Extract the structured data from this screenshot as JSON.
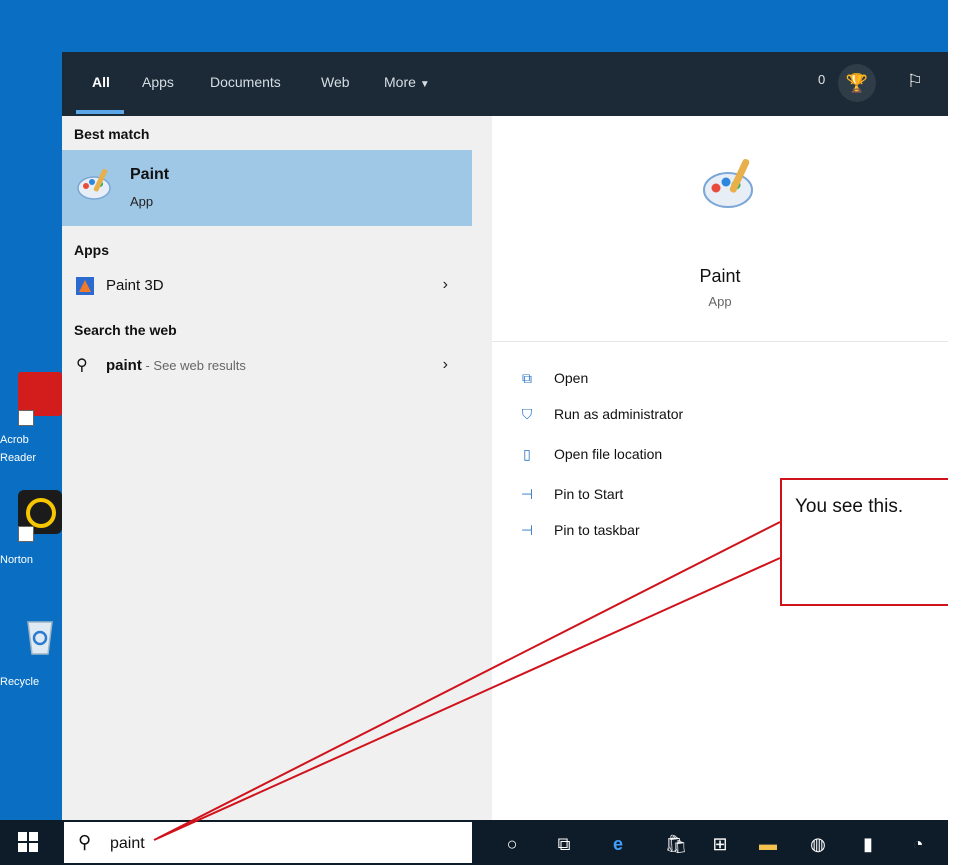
{
  "desktop": {
    "icons": [
      {
        "label_line1": "Acrob",
        "label_line2": "Reader"
      },
      {
        "label_line1": "Norton"
      },
      {
        "label_line1": "Recycle"
      }
    ]
  },
  "search_panel": {
    "tabs": [
      {
        "label": "All"
      },
      {
        "label": "Apps"
      },
      {
        "label": "Documents"
      },
      {
        "label": "Web"
      },
      {
        "label": "More"
      }
    ],
    "points": "0",
    "best_match": {
      "section_title": "Best match",
      "name": "Paint",
      "type": "App"
    },
    "apps": {
      "section_title": "Apps",
      "items": [
        {
          "name": "Paint 3D"
        }
      ]
    },
    "web": {
      "section_title": "Search the web",
      "query": "paint",
      "suffix": " - See web results"
    },
    "details": {
      "name": "Paint",
      "type": "App",
      "actions": [
        {
          "label": "Open",
          "icon": "open-icon"
        },
        {
          "label": "Run as administrator",
          "icon": "shield-admin-icon"
        },
        {
          "label": "Open file location",
          "icon": "file-location-icon"
        },
        {
          "label": "Pin to Start",
          "icon": "pin-icon"
        },
        {
          "label": "Pin to taskbar",
          "icon": "pin-icon"
        }
      ]
    }
  },
  "taskbar": {
    "search_value": "paint"
  },
  "annotation": {
    "text": "You see this.",
    "color": "#d0121b"
  }
}
